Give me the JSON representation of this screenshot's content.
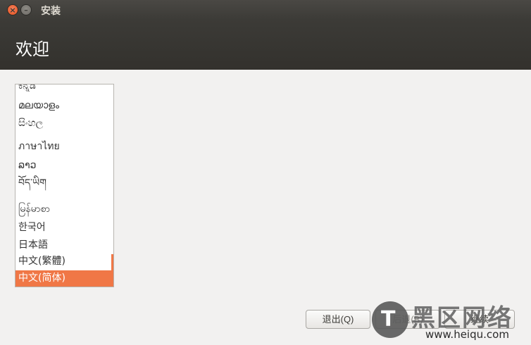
{
  "window": {
    "title": "安装"
  },
  "header": {
    "title": "欢迎"
  },
  "languages": [
    {
      "label": "ಕನ್ನಡ",
      "selected": false
    },
    {
      "label": "മലയാളം",
      "selected": false
    },
    {
      "label": "සිංහල",
      "selected": false
    },
    {
      "label": "ภาษาไทย",
      "selected": false
    },
    {
      "label": "ລາວ",
      "selected": false
    },
    {
      "label": "བོད་ཡིག",
      "selected": false
    },
    {
      "label": "မြန်မာစာ",
      "selected": false
    },
    {
      "label": "한국어",
      "selected": false
    },
    {
      "label": "日本語",
      "selected": false
    },
    {
      "label": "中文(繁體)",
      "selected": false
    },
    {
      "label": "中文(简体)",
      "selected": true
    }
  ],
  "buttons": {
    "quit": "退出(Q)",
    "back": "后退(B)",
    "next": "继续"
  },
  "watermark": {
    "text": "黑区网络",
    "url": "www.heiqu.com",
    "logo_letter": "T"
  },
  "colors": {
    "accent": "#f07746",
    "header_bg": "#3c3b37",
    "page_bg": "#f2f1f0"
  }
}
